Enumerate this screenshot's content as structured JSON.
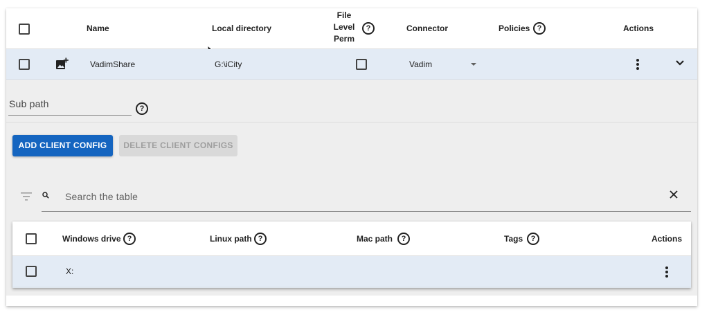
{
  "table": {
    "columns": {
      "name": "Name",
      "local_directory": "Local directory",
      "file_level_perm": [
        "File",
        "Level",
        "Perm"
      ],
      "connector": "Connector",
      "policies": "Policies",
      "actions": "Actions"
    },
    "help_icon_glyph": "?",
    "row": {
      "name": "VadimShare",
      "local_directory": "G:\\iCity",
      "connector": "Vadim",
      "file_level_perm_checked": false
    }
  },
  "expanded": {
    "sub_path": {
      "label": "Sub path",
      "value": ""
    },
    "buttons": {
      "add": "ADD CLIENT CONFIG",
      "delete": "DELETE CLIENT CONFIGS"
    },
    "search": {
      "placeholder": "Search the table",
      "clear_glyph": "✕"
    },
    "client_table": {
      "columns": {
        "windows_drive": "Windows drive",
        "linux_path": "Linux path",
        "mac_path": "Mac path",
        "tags": "Tags",
        "actions": "Actions"
      },
      "rows": [
        {
          "windows_drive": "X:",
          "linux_path": "",
          "mac_path": "",
          "tags": ""
        }
      ]
    }
  },
  "colors": {
    "accent": "#1565c0",
    "selected_row": "#e3ebf5",
    "panel_bg": "#eeeeee"
  }
}
